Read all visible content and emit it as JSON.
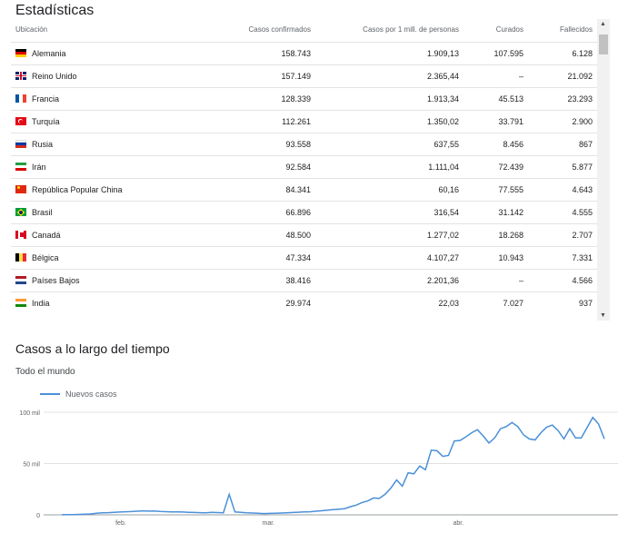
{
  "stats": {
    "title": "Estadísticas",
    "columns": {
      "location": "Ubicación",
      "confirmed": "Casos confirmados",
      "per_million": "Casos por 1 mill. de personas",
      "recovered": "Curados",
      "deaths": "Fallecidos"
    },
    "rows": [
      {
        "flag": "germany-flag-icon",
        "location": "Alemania",
        "confirmed": "158.743",
        "per_million": "1.909,13",
        "recovered": "107.595",
        "deaths": "6.128"
      },
      {
        "flag": "uk-flag-icon",
        "location": "Reino Unido",
        "confirmed": "157.149",
        "per_million": "2.365,44",
        "recovered": "–",
        "deaths": "21.092"
      },
      {
        "flag": "france-flag-icon",
        "location": "Francia",
        "confirmed": "128.339",
        "per_million": "1.913,34",
        "recovered": "45.513",
        "deaths": "23.293"
      },
      {
        "flag": "turkey-flag-icon",
        "location": "Turquía",
        "confirmed": "112.261",
        "per_million": "1.350,02",
        "recovered": "33.791",
        "deaths": "2.900"
      },
      {
        "flag": "russia-flag-icon",
        "location": "Rusia",
        "confirmed": "93.558",
        "per_million": "637,55",
        "recovered": "8.456",
        "deaths": "867"
      },
      {
        "flag": "iran-flag-icon",
        "location": "Irán",
        "confirmed": "92.584",
        "per_million": "1.111,04",
        "recovered": "72.439",
        "deaths": "5.877"
      },
      {
        "flag": "china-flag-icon",
        "location": "República Popular China",
        "confirmed": "84.341",
        "per_million": "60,16",
        "recovered": "77.555",
        "deaths": "4.643"
      },
      {
        "flag": "brazil-flag-icon",
        "location": "Brasil",
        "confirmed": "66.896",
        "per_million": "316,54",
        "recovered": "31.142",
        "deaths": "4.555"
      },
      {
        "flag": "canada-flag-icon",
        "location": "Canadá",
        "confirmed": "48.500",
        "per_million": "1.277,02",
        "recovered": "18.268",
        "deaths": "2.707"
      },
      {
        "flag": "belgium-flag-icon",
        "location": "Bélgica",
        "confirmed": "47.334",
        "per_million": "4.107,27",
        "recovered": "10.943",
        "deaths": "7.331"
      },
      {
        "flag": "netherlands-flag-icon",
        "location": "Países Bajos",
        "confirmed": "38.416",
        "per_million": "2.201,36",
        "recovered": "–",
        "deaths": "4.566"
      },
      {
        "flag": "india-flag-icon",
        "location": "India",
        "confirmed": "29.974",
        "per_million": "22,03",
        "recovered": "7.027",
        "deaths": "937"
      }
    ]
  },
  "chart_section": {
    "title": "Casos a lo largo del tiempo",
    "scope": "Todo el mundo"
  },
  "chart_data": {
    "type": "line",
    "legend": "Nuevos casos",
    "legend_position": "top-left",
    "line_color": "#4a90d9",
    "x_tick_labels": [
      "feb.",
      "mar.",
      "abr."
    ],
    "y_tick_labels": [
      "0",
      "50 mil",
      "100 mil"
    ],
    "ylim": [
      0,
      100000
    ],
    "grid": true,
    "series": [
      {
        "name": "Nuevos casos",
        "values": [
          100,
          200,
          300,
          400,
          600,
          900,
          1500,
          2000,
          2100,
          2500,
          2700,
          3000,
          3200,
          3500,
          3900,
          3600,
          3800,
          3400,
          3100,
          2900,
          2800,
          2700,
          2500,
          2300,
          2100,
          2000,
          2400,
          2200,
          2000,
          20000,
          2800,
          2500,
          2000,
          1800,
          1500,
          1200,
          1400,
          1600,
          1800,
          2000,
          2300,
          2600,
          2800,
          3000,
          3500,
          4000,
          4500,
          5000,
          5500,
          6000,
          8000,
          9500,
          12000,
          13500,
          16500,
          16000,
          20000,
          26000,
          34000,
          28000,
          41000,
          40000,
          47500,
          44000,
          63000,
          62500,
          57000,
          58000,
          72000,
          72500,
          76000,
          80000,
          83000,
          77000,
          70000,
          75000,
          84000,
          86000,
          90000,
          86000,
          78000,
          74000,
          73000,
          80000,
          85500,
          87500,
          82000,
          74000,
          84000,
          75000,
          75000,
          85000,
          95000,
          88500,
          74000
        ]
      }
    ]
  }
}
